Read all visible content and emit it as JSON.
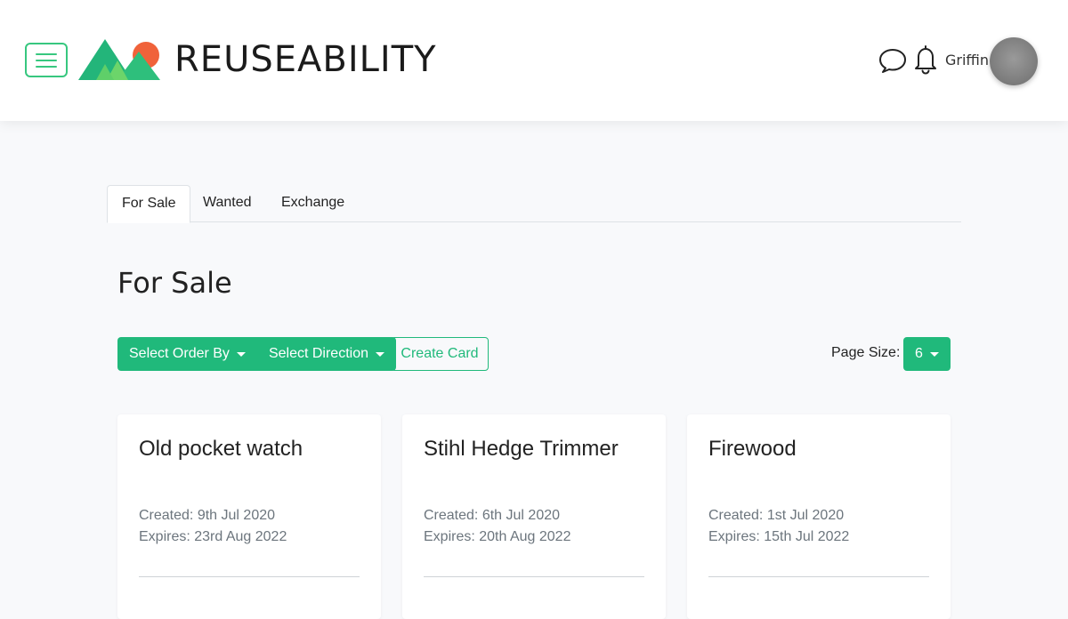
{
  "header": {
    "brand": "REUSEABILITY",
    "username": "Griffin",
    "colors": {
      "accent": "#37c77f",
      "brand_text": "#1b1b1b"
    }
  },
  "tabs": [
    {
      "label": "For Sale",
      "active": true
    },
    {
      "label": "Wanted",
      "active": false
    },
    {
      "label": "Exchange",
      "active": false
    }
  ],
  "main": {
    "title": "For Sale",
    "order_by_label": "Select Order By",
    "direction_label": "Select Direction",
    "create_label": "Create Card",
    "page_size_label": "Page Size:",
    "page_size_value": "6",
    "colors": {
      "primary": "#20b97b"
    }
  },
  "cards": [
    {
      "title": "Old pocket watch",
      "created_label": "Created:",
      "created": "9th Jul 2020",
      "expires_label": "Expires:",
      "expires": "23rd Aug 2022"
    },
    {
      "title": "Stihl Hedge Trimmer",
      "created_label": "Created:",
      "created": "6th Jul 2020",
      "expires_label": "Expires:",
      "expires": "20th Aug 2022"
    },
    {
      "title": "Firewood",
      "created_label": "Created:",
      "created": "1st Jul 2020",
      "expires_label": "Expires:",
      "expires": "15th Jul 2022"
    }
  ],
  "icons": [
    "menu-icon",
    "logo-icon",
    "chat-icon",
    "bell-icon"
  ]
}
